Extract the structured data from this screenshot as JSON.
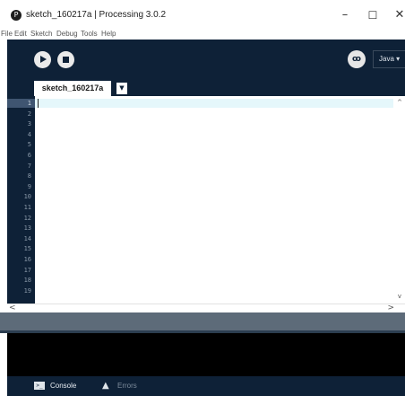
{
  "window": {
    "title": "sketch_160217a | Processing 3.0.2",
    "app_icon": "processing-icon",
    "controls": {
      "minimize": "–",
      "maximize": "☐",
      "close": "✕"
    }
  },
  "menu": {
    "items": [
      "File",
      "Edit",
      "Sketch",
      "Debug",
      "Tools",
      "Help"
    ]
  },
  "toolbar": {
    "run_icon": "play-icon",
    "stop_icon": "stop-icon",
    "debug_icon": "butterfly-icon",
    "debug_glyph": "ꝏ",
    "mode": "Java ▾"
  },
  "tabs": [
    {
      "label": "sketch_160217a"
    }
  ],
  "tab_menu_glyph": "▼",
  "editor": {
    "line_numbers": [
      "1",
      "2",
      "3",
      "4",
      "5",
      "6",
      "7",
      "8",
      "9",
      "10",
      "11",
      "12",
      "13",
      "14",
      "15",
      "16",
      "17",
      "18",
      "19"
    ],
    "active_line": 1
  },
  "scroll": {
    "up": "^",
    "down": "v",
    "left": "<",
    "right": ">"
  },
  "footer": {
    "console_label": "Console",
    "errors_label": "Errors",
    "console_glyph": ">_",
    "errors_glyph": "▲"
  },
  "colors": {
    "chrome_dark": "#0e2137",
    "gutter_active": "#3f5571",
    "active_line": "#e5f7fb",
    "divider": "#5d6b79",
    "console_bg": "#000000"
  }
}
